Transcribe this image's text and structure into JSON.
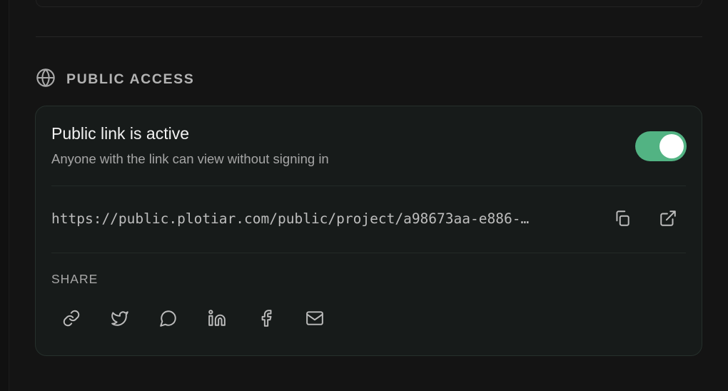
{
  "section": {
    "title": "PUBLIC ACCESS",
    "icon": "globe-icon"
  },
  "public_link": {
    "status_title": "Public link is active",
    "status_subtitle": "Anyone with the link can view without signing in",
    "toggle_on": true,
    "toggle_color": "#52b383",
    "url": "https://public.plotiar.com/public/project/a98673aa-e886-…",
    "copy_icon": "copy-icon",
    "open_icon": "external-link-icon"
  },
  "share": {
    "label": "SHARE",
    "items": [
      {
        "name": "copy-link",
        "icon": "link-icon"
      },
      {
        "name": "twitter",
        "icon": "twitter-icon"
      },
      {
        "name": "chat",
        "icon": "chat-bubble-icon"
      },
      {
        "name": "linkedin",
        "icon": "linkedin-icon"
      },
      {
        "name": "facebook",
        "icon": "facebook-icon"
      },
      {
        "name": "email",
        "icon": "mail-icon"
      }
    ]
  }
}
